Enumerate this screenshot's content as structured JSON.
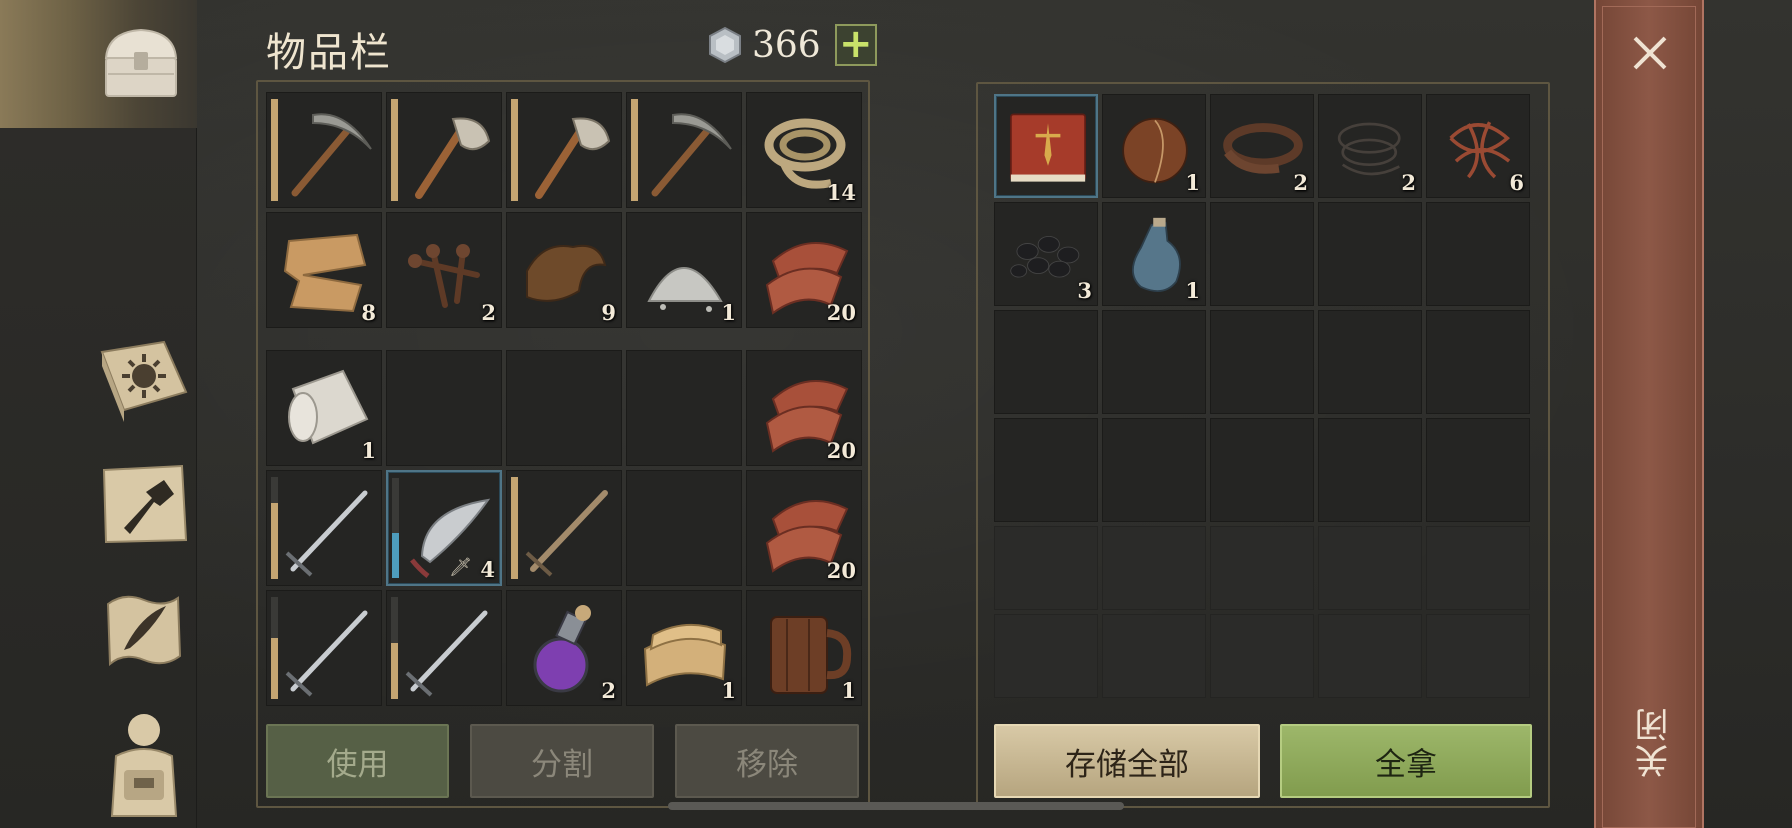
{
  "header": {
    "title": "物品栏",
    "currency_value": "366",
    "add_label": "+"
  },
  "nav": {
    "items": [
      {
        "icon": "chest-icon",
        "active": true
      },
      {
        "icon": "sun-book-icon",
        "active": false
      },
      {
        "icon": "crafting-hammer-icon",
        "active": false
      },
      {
        "icon": "quill-scroll-icon",
        "active": false
      },
      {
        "icon": "backpack-character-icon",
        "active": false
      }
    ]
  },
  "inventory_top": [
    {
      "icon": "pickaxe-icon",
      "durability": 1.0
    },
    {
      "icon": "axe-icon",
      "durability": 1.0
    },
    {
      "icon": "axe-icon",
      "durability": 1.0
    },
    {
      "icon": "pickaxe-icon",
      "durability": 1.0
    },
    {
      "icon": "rope-icon",
      "count": "14"
    },
    {
      "icon": "cloth-scrap-icon",
      "count": "8"
    },
    {
      "icon": "nails-icon",
      "count": "2"
    },
    {
      "icon": "leather-icon",
      "count": "9"
    },
    {
      "icon": "salt-pile-icon",
      "count": "1"
    },
    {
      "icon": "raw-meat-icon",
      "count": "20"
    }
  ],
  "inventory_bottom": [
    {
      "icon": "cloth-roll-icon",
      "count": "1"
    },
    {
      "icon": "",
      "count": ""
    },
    {
      "icon": "",
      "count": ""
    },
    {
      "icon": "",
      "count": ""
    },
    {
      "icon": "raw-meat-icon",
      "count": "20"
    },
    {
      "icon": "sword-icon",
      "durability": 0.75
    },
    {
      "icon": "scimitar-icon",
      "count": "4",
      "durability": 0.45,
      "selected": true
    },
    {
      "icon": "wooden-sword-icon",
      "durability": 1.0
    },
    {
      "icon": "",
      "count": ""
    },
    {
      "icon": "raw-meat-icon",
      "count": "20"
    },
    {
      "icon": "sword-icon",
      "durability": 0.6
    },
    {
      "icon": "sword-icon",
      "durability": 0.55
    },
    {
      "icon": "potion-icon",
      "count": "2"
    },
    {
      "icon": "folded-fabric-icon",
      "count": "1"
    },
    {
      "icon": "wooden-mug-icon",
      "count": "1"
    }
  ],
  "container_items": [
    {
      "icon": "red-book-icon",
      "selected": true
    },
    {
      "icon": "leather-flask-icon",
      "count": "1"
    },
    {
      "icon": "leather-strap-icon",
      "count": "2"
    },
    {
      "icon": "wire-coil-icon",
      "count": "2"
    },
    {
      "icon": "tangled-cord-icon",
      "count": "6"
    },
    {
      "icon": "coal-icon",
      "count": "3"
    },
    {
      "icon": "glass-bottle-icon",
      "count": "1"
    }
  ],
  "buttons": {
    "use": "使用",
    "split": "分割",
    "remove": "移除",
    "store_all": "存储全部",
    "take_all": "全拿",
    "close": "关闭"
  },
  "colors": {
    "accent_green": "#9db76a",
    "close_rail": "#8d5847",
    "selection_blue": "#4f7587",
    "durability_gold": "#c4a572"
  }
}
